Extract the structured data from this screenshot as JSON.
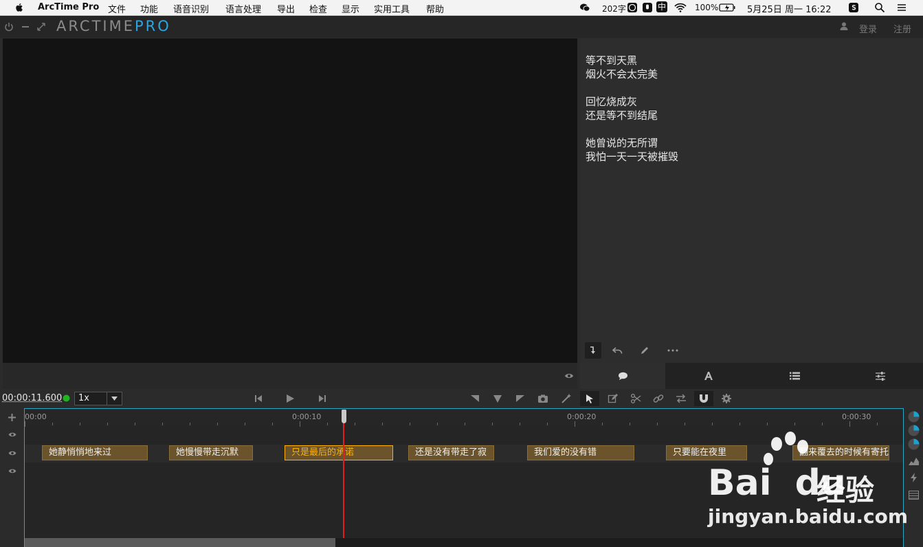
{
  "menubar": {
    "app_name": "ArcTime Pro",
    "items": [
      "文件",
      "功能",
      "语音识别",
      "语言处理",
      "导出",
      "检查",
      "显示",
      "实用工具",
      "帮助"
    ],
    "word_count": "202字",
    "ime": "中",
    "battery": "100%",
    "datetime": "5月25日 周一  16:22"
  },
  "header": {
    "logo_main": "ARCTIME",
    "logo_pro": "PRO",
    "login": "登录",
    "register": "注册"
  },
  "lyrics": [
    "等不到天黑",
    "烟火不会太完美",
    "",
    "回忆烧成灰",
    "还是等不到结尾",
    "",
    "她曾说的无所谓",
    "我怕一天一天被摧毁"
  ],
  "controls": {
    "timecode": "00:00:11.600",
    "speed": "1x"
  },
  "timeline": {
    "labels": [
      "00:00",
      "0:00:10",
      "0:00:20",
      "0:00:30"
    ],
    "clips": [
      "她静悄悄地来过",
      "她慢慢带走沉默",
      "只是最后的承诺",
      "还是没有带走了寂",
      "我们爱的没有错",
      "只要能在夜里",
      "翻来覆去的时候有寄托"
    ]
  },
  "watermark": {
    "brand": "Bai",
    "brand2": "du",
    "cn": "经验",
    "url": "jingyan.baidu.com"
  },
  "colors": {
    "accent": "#2aa7e0",
    "clip_bg": "#6b542b",
    "clip_selected": "#ffb000",
    "playhead": "#e02020"
  }
}
